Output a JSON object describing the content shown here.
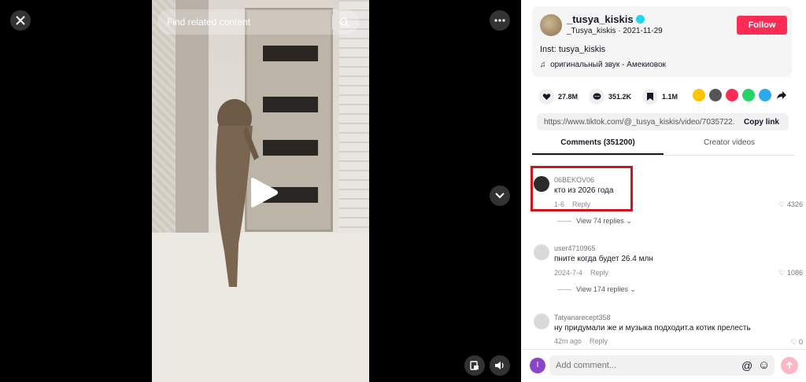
{
  "video": {
    "search_placeholder": "Find related content"
  },
  "author": {
    "username": "_tusya_kiskis",
    "handle": "_Tusya_kiskis",
    "date": "2021-11-29",
    "follow_label": "Follow",
    "description": "Inst: tusya_kiskis",
    "music": "оригинальный звук - Амекиовок"
  },
  "stats": {
    "likes": "27.8M",
    "comments": "351.2K",
    "saves": "1.1M"
  },
  "link": {
    "url": "https://www.tiktok.com/@_tusya_kiskis/video/7035722...",
    "copy_label": "Copy link"
  },
  "tabs": [
    {
      "label": "Comments (351200)"
    },
    {
      "label": "Creator videos"
    }
  ],
  "comments": [
    {
      "user": "06BEKOV06",
      "text": "кто из 2026 года",
      "date": "1-6",
      "reply": "Reply",
      "likes": "4326",
      "view_replies": "View 74 replies"
    },
    {
      "user": "user4710965",
      "text": "пните когда будет 26.4 млн",
      "date": "2024-7-4",
      "reply": "Reply",
      "likes": "1086",
      "view_replies": "View 174 replies"
    },
    {
      "user": "Tatyanarecept358",
      "text": "ну придумали же и музыка подходит.а котик прелесть",
      "date": "42m ago",
      "reply": "Reply",
      "likes": "0"
    }
  ],
  "composer": {
    "avatar_letter": "I",
    "placeholder": "Add comment...",
    "mention_symbol": "@"
  },
  "colors": {
    "follow": "#fe2c55",
    "highlight": "#d0141c",
    "verified": "#20d5ec"
  }
}
